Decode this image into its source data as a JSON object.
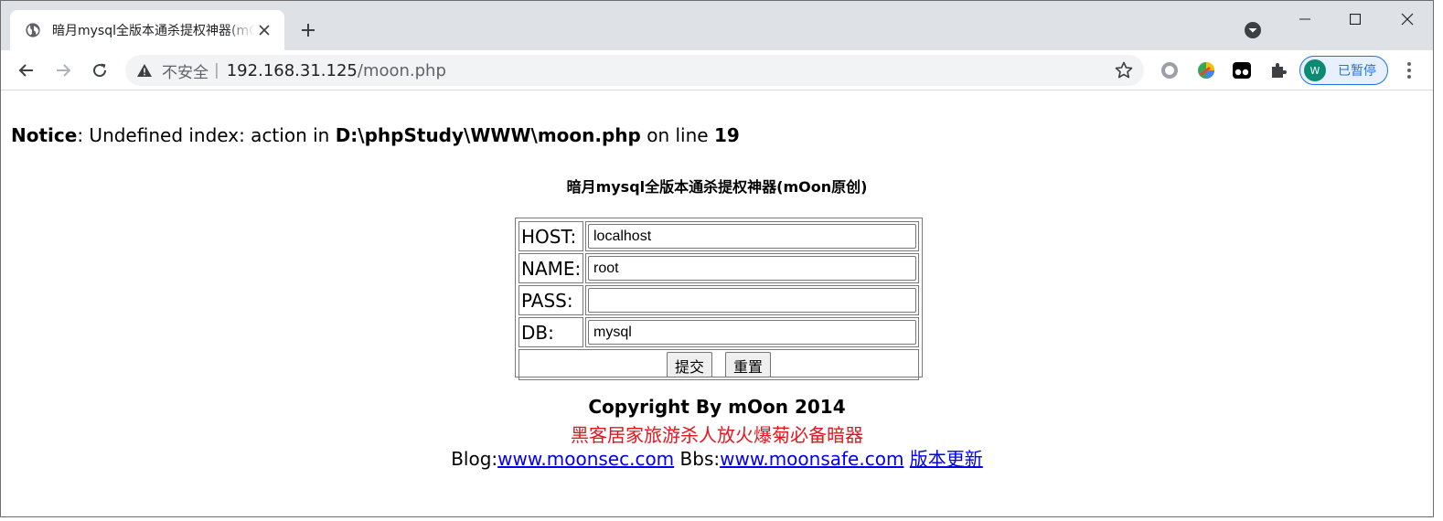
{
  "browser": {
    "tab_title": "暗月mysql全版本通杀提权神器(mOon原创)",
    "address_insecure": "不安全",
    "address_separator": "|",
    "address_host": "192.168.31.125",
    "address_path": "/moon.php",
    "profile_initial": "W",
    "profile_label": "已暂停",
    "accent_color": "#1a73e8"
  },
  "page": {
    "notice": {
      "label": "Notice",
      "text_a": ": Undefined index: action in ",
      "path": "D:\\phpStudy\\WWW\\moon.php",
      "text_b": " on line ",
      "line": "19"
    },
    "heading": "暗月mysql全版本通杀提权神器(mOon原创)",
    "form": {
      "rows": [
        {
          "label": "HOST:",
          "value": "localhost"
        },
        {
          "label": "NAME:",
          "value": "root"
        },
        {
          "label": "PASS:",
          "value": ""
        },
        {
          "label": "DB:",
          "value": "mysql"
        }
      ],
      "submit_label": "提交",
      "reset_label": "重置"
    },
    "copyright": "Copyright By mOon 2014",
    "slogan": "黑客居家旅游杀人放火爆菊必备暗器",
    "slogan_color": "#e8141b",
    "blog_label": "Blog:",
    "blog_link": "www.moonsec.com",
    "bbs_label": "Bbs:",
    "bbs_link": "www.moonsafe.com",
    "update_link": "版本更新"
  }
}
